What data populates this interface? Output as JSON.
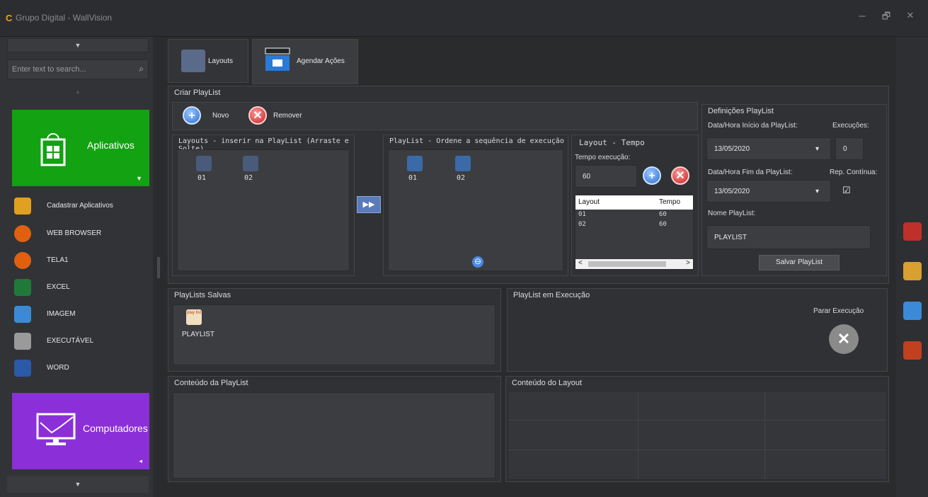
{
  "window": {
    "logo": "C",
    "title": "Grupo Digital - WallVision",
    "min": "–",
    "restore": "🗗",
    "close": "✕"
  },
  "sidebar": {
    "scroll_up": "▼",
    "search_placeholder": "Enter text to search...",
    "tile_apps": {
      "label": "Aplicativos",
      "arrow": "▼"
    },
    "items": [
      {
        "label": "Cadastrar Aplicativos",
        "icon": "register-apps-icon",
        "color": "#e0a020"
      },
      {
        "label": "WEB BROWSER",
        "icon": "firefox-icon",
        "color": "#e06010"
      },
      {
        "label": "TELA1",
        "icon": "firefox-icon",
        "color": "#e06010"
      },
      {
        "label": "EXCEL",
        "icon": "excel-icon",
        "color": "#1f7a3a"
      },
      {
        "label": "IMAGEM",
        "icon": "image-icon",
        "color": "#3a8ad8"
      },
      {
        "label": "EXECUTÁVEL",
        "icon": "executable-icon",
        "color": "#9a9a9a"
      },
      {
        "label": "WORD",
        "icon": "word-icon",
        "color": "#2a5aa8"
      }
    ],
    "tile_computers": {
      "label": "Computadores",
      "arrow": "◂"
    },
    "scroll_down": "▼"
  },
  "tabs": [
    {
      "label": "Layouts"
    },
    {
      "label": "Agendar Ações"
    }
  ],
  "criar": {
    "title": "Criar PlayList",
    "novo": "Novo",
    "remover": "Remover",
    "layouts_panel": {
      "title": "Layouts - inserir na PlayList (Arraste e Solte)",
      "items": [
        "01",
        "02"
      ]
    },
    "playlist_panel": {
      "title": "PlayList - Ordene a sequência de execução",
      "items": [
        "01",
        "02"
      ]
    },
    "tempo_panel": {
      "title": "Layout - Tempo",
      "tempo_label": "Tempo execução:",
      "tempo_value": "60",
      "columns": [
        "Layout",
        "Tempo"
      ],
      "rows": [
        [
          "01",
          "60"
        ],
        [
          "02",
          "60"
        ]
      ],
      "scroll_left": "<",
      "scroll_right": ">"
    },
    "add_arrow": "▶▶",
    "remove_item": "⊖"
  },
  "definicoes": {
    "title": "Definições PlayList",
    "inicio_label": "Data/Hora Início da PlayList:",
    "inicio_value": "13/05/2020",
    "execucoes_label": "Execuções:",
    "execucoes_value": "0",
    "fim_label": "Data/Hora Fim da PlayList:",
    "fim_value": "13/05/2020",
    "rep_label": "Rep. Contínua:",
    "rep_checked": "☑",
    "nome_label": "Nome PlayList:",
    "nome_value": "PLAYLIST",
    "salvar": "Salvar PlayList",
    "dropdown": "▾"
  },
  "salvas": {
    "title": "PlayLists Salvas",
    "items": [
      {
        "label": "PLAYLIST",
        "icon_text": "play list"
      }
    ]
  },
  "execucao": {
    "title": "PlayList em Execução",
    "parar": "Parar Execução",
    "parar_icon": "✕"
  },
  "conteudo_playlist": {
    "title": "Conteúdo da PlayList"
  },
  "conteudo_layout": {
    "title": "Conteúdo do Layout"
  },
  "rightbar": [
    {
      "icon": "toolbox-icon",
      "color": "#c0302a"
    },
    {
      "icon": "search-person-icon",
      "color": "#d8a030"
    },
    {
      "icon": "clapperboard-icon",
      "color": "#3a8ad8"
    },
    {
      "icon": "broom-icon",
      "color": "#c04020"
    }
  ]
}
